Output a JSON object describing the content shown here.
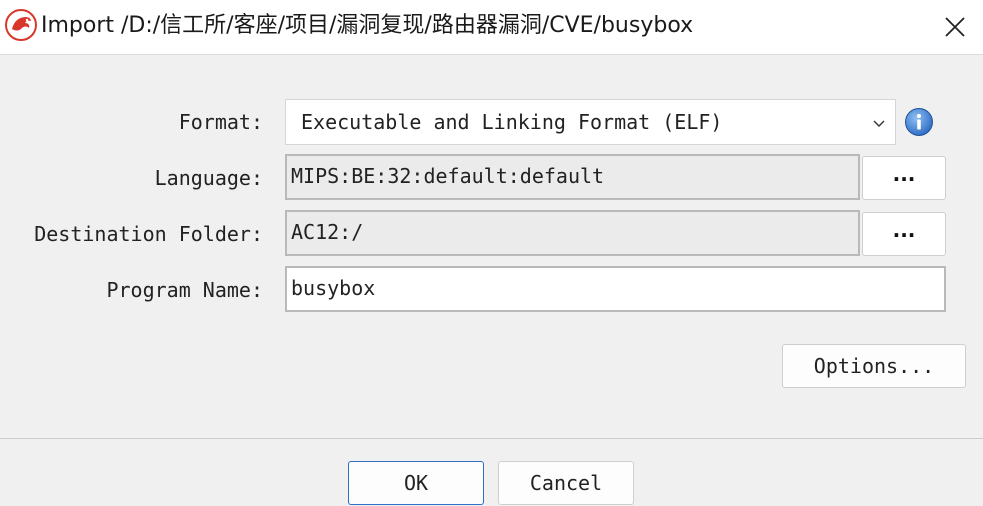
{
  "window": {
    "title": "Import /D:/信工所/客座/项目/漏洞复现/路由器漏洞/CVE/busybox",
    "app_icon": "ghidra-dragon-icon",
    "close_icon": "close-icon"
  },
  "form": {
    "format_label": "Format:",
    "format_value": "Executable and Linking Format (ELF)",
    "language_label": "Language:",
    "language_value": "MIPS:BE:32:default:default",
    "destination_label": "Destination Folder:",
    "destination_value": "AC12:/",
    "program_name_label": "Program Name:",
    "program_name_value": "busybox",
    "browse_label": "..."
  },
  "buttons": {
    "options": "Options...",
    "ok": "OK",
    "cancel": "Cancel"
  },
  "colors": {
    "info_blue": "#3b7fd6",
    "dragon_red": "#d9372b",
    "ok_border": "#2f6fc6"
  }
}
